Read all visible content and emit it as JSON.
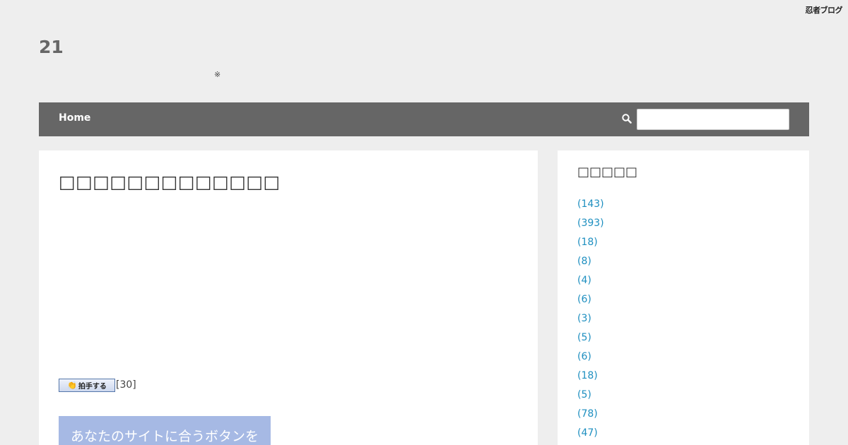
{
  "ninja_logo": "忍者ブログ",
  "site": {
    "title": "21",
    "description": "※"
  },
  "nav": {
    "home_label": "Home",
    "search_placeholder": ""
  },
  "entry": {
    "title": "□□□□□□□□□□□□□",
    "clap_button_label": "拍手する",
    "clap_count": "[30]",
    "ad_text": "あなたのサイトに合うボタンを"
  },
  "sidebar": {
    "title": "□□□□□",
    "categories": [
      {
        "count": "(143)"
      },
      {
        "count": "(393)"
      },
      {
        "count": "(18)"
      },
      {
        "count": "(8)"
      },
      {
        "count": "(4)"
      },
      {
        "count": "(6)"
      },
      {
        "count": "(3)"
      },
      {
        "count": "(5)"
      },
      {
        "count": "(6)"
      },
      {
        "count": "(18)"
      },
      {
        "count": "(5)"
      },
      {
        "count": "(78)"
      },
      {
        "count": "(47)"
      }
    ]
  }
}
